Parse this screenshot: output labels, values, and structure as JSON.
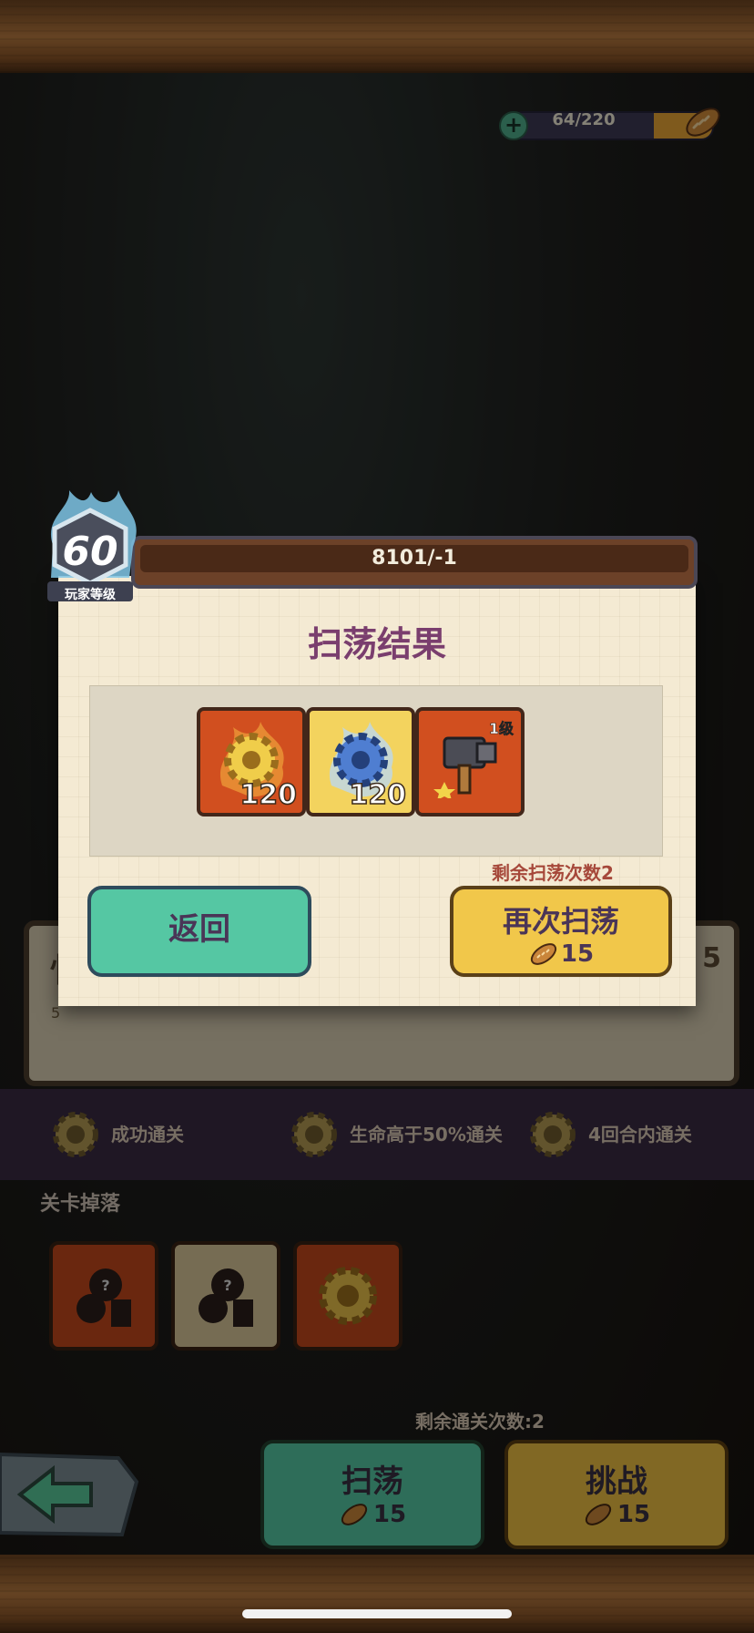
{
  "stamina": {
    "current": "64/220",
    "fill_fraction": 0.29
  },
  "modal": {
    "player_level": "60",
    "player_level_label": "玩家等级",
    "stage_id": "8101/-1",
    "title": "扫荡结果",
    "rewards": [
      {
        "icon": "gold-gear-icon",
        "count": "120"
      },
      {
        "icon": "blue-gear-icon",
        "count": "120"
      },
      {
        "icon": "hammer-icon",
        "level": "1级"
      }
    ],
    "remaining_sweeps": "剩余扫荡次数2",
    "return_label": "返回",
    "sweep_again_label": "再次扫荡",
    "sweep_again_cost": "15"
  },
  "background": {
    "frag_left": "5",
    "conditions": [
      "成功通关",
      "生命高于50%通关",
      "4回合内通关"
    ],
    "drops_title": "关卡掉落",
    "remaining_clears": "剩余通关次数:2",
    "sweep_label": "扫荡",
    "sweep_cost": "15",
    "challenge_label": "挑战",
    "challenge_cost": "15"
  }
}
